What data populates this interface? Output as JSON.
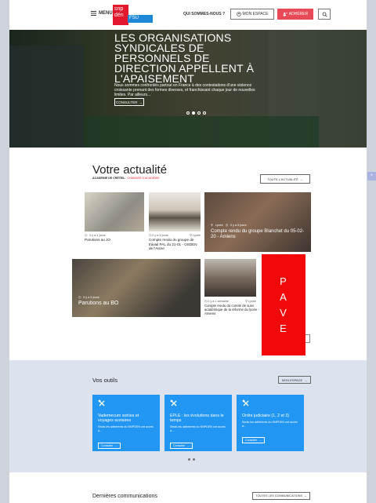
{
  "nav": {
    "menu_label": "MENU",
    "logo": {
      "line1": "snp",
      "line2": "dén",
      "badge": "FSU"
    },
    "who_label": "QUI SOMMES-NOUS ?",
    "space_label": "MON ESPACE",
    "join_label": "ADHÉRER"
  },
  "hero": {
    "title": "LES ORGANISATIONS SYNDICALES DE PERSONNELS DE DIRECTION APPELLENT À L'APAISEMENT",
    "text": "Nous sommes confrontés partout en France à des contestations d'une violence croissante prenant des formes diverses, et franchissant chaque jour de nouvelles limites. Par ailleurs...",
    "button": "CONSULTER"
  },
  "news": {
    "title": "Votre actualité",
    "academy": "ACADÉMIE DE CRÉTEIL",
    "academy_tag": "CHANGER D'ACADÉMIE",
    "all_button": "TOUTE L'ACTUALITÉ",
    "cards": [
      {
        "meta": "Il y a 4 jours",
        "title": "Parutions au JO"
      },
      {
        "meta": "Il y a 5 jours",
        "location": "Lycée",
        "title": "Compte rendu du groupe de travail PAL du 21-01 - OSDEN de l'Aisne"
      },
      {
        "meta_a": "Lycée",
        "meta_b": "Il y a 5 jours",
        "title": "Compte rendu du groupe Blanchet du 05-02-20 - Amiens"
      },
      {
        "meta": "Il y a 5 jours",
        "title": "Parutions au BO"
      },
      {
        "meta": "Il y a 1 semaine",
        "location": "Lycée",
        "title": "Compte rendu du comité de suivi académique de la réforme du lycée - Amiens"
      }
    ]
  },
  "pave": [
    "P",
    "A",
    "V",
    "E"
  ],
  "tools": {
    "title": "Vos outils",
    "space_button": "MON ESPACE",
    "cards": [
      {
        "title": "Vademecum sorties et voyages scolaires",
        "text": "Seuls les adhérents du SNPDEN ont accès à...",
        "button": "Consulter"
      },
      {
        "title": "EPLE : les évolutions dans le temps",
        "text": "Seuls les adhérents du SNPDEN ont accès à...",
        "button": "Consulter"
      },
      {
        "title": "Ordre judiciaire (1, 2 et 3)",
        "text": "Seuls les adhérents du SNPDEN ont accès à...",
        "button": "Consulter"
      }
    ]
  },
  "comms": {
    "title": "Dernières communications",
    "button": "TOUTES LES COMMUNICATIONS"
  }
}
